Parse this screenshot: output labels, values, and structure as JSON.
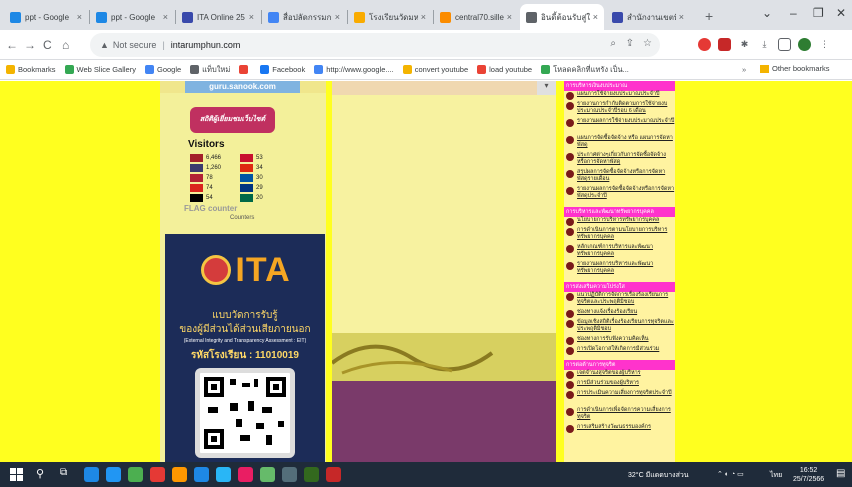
{
  "browser": {
    "tabs": [
      {
        "title": "ppt - Google",
        "color": "#1e88e5"
      },
      {
        "title": "ppt - Google",
        "color": "#1e88e5"
      },
      {
        "title": "ITA Online 25",
        "color": "#3949ab"
      },
      {
        "title": "สื่อปลัดกรรมการ",
        "color": "#4285f4"
      },
      {
        "title": "โรงเรียนวัดมหาก",
        "color": "#f9ab00"
      },
      {
        "title": "central70.sille",
        "color": "#fb8c00"
      },
      {
        "title": "อินดี้ต้อนรับสู่ใ",
        "color": "#5f6368"
      },
      {
        "title": "สำนักงานเขตพื้",
        "color": "#3949ab"
      }
    ],
    "active_tab_index": 6,
    "close_glyph": "×",
    "new_tab_glyph": "+",
    "window_controls": [
      "⌄",
      "–",
      "❐",
      "✕"
    ]
  },
  "address": {
    "back": "←",
    "forward": "→",
    "reload": "C",
    "home": "⌂",
    "security_label": "Not secure",
    "url": "intarumphun.com"
  },
  "bookmarks": [
    {
      "label": "Bookmarks",
      "color": "#f4b400"
    },
    {
      "label": "Web Slice Gallery",
      "color": "#34a853"
    },
    {
      "label": "Google",
      "color": "#4285f4"
    },
    {
      "label": "แท็บใหม่",
      "color": "#5f6368"
    },
    {
      "label": "",
      "color": "#ea4335"
    },
    {
      "label": "Facebook",
      "color": "#1877f2"
    },
    {
      "label": "http://www.google....",
      "color": "#4285f4"
    },
    {
      "label": "convert youtube",
      "color": "#f4b400"
    },
    {
      "label": "load youtube",
      "color": "#ea4335"
    },
    {
      "label": "โหลดคลิกที่แทรัง เป็น...",
      "color": "#34a853"
    }
  ],
  "other_bookmarks": "Other bookmarks",
  "bookmarks_more": "»",
  "page": {
    "left": {
      "gsite_label": "guru.sanook.com",
      "stats_label": "สถิติผู้เยี่ยมชมเว็บไซต์",
      "visitors_title": "Visitors",
      "visitors": [
        {
          "count": "6,466",
          "color": "#a3202a"
        },
        {
          "count": "53",
          "color": "#c8102e"
        },
        {
          "count": "1,260",
          "color": "#3c3b6e"
        },
        {
          "count": "34",
          "color": "#de2910"
        },
        {
          "count": "78",
          "color": "#b22234"
        },
        {
          "count": "30",
          "color": "#0055a4"
        },
        {
          "count": "74",
          "color": "#da251d"
        },
        {
          "count": "29",
          "color": "#003580"
        },
        {
          "count": "54",
          "color": "#000000"
        },
        {
          "count": "20",
          "color": "#006847"
        }
      ],
      "flag_counter": "FLAG counter",
      "counters_label": "Counters"
    },
    "ita": {
      "logo_text": "ITA",
      "line1": "แบบวัดการรับรู้",
      "line2": "ของผู้มีส่วนได้ส่วนเสียภายนอก",
      "line3": "(External Integrity and Transparency Assessment : EIT)",
      "line4": "รหัสโรงเรียน : 11010019"
    },
    "right_sections": [
      {
        "heading": "การบริหารเงินงบประมาณ",
        "items": [
          "แผนการใช้จ่ายงบประมาณประจำปี",
          "รายงานการกำกับติดตามการใช้จ่ายงบประมาณประจำปีรอบ 6 เดือน",
          "รายงานผลการใช้จ่ายงบประมาณประจำปี",
          "แผนการจัดซื้อจัดจ้าง หรือ แผนการจัดหาพัสดุ",
          "ประกาศต่างๆเกี่ยวกับการจัดซื้อจัดจ้างหรือการจัดหาพัสดุ",
          "สรุปผลการจัดซื้อจัดจ้างหรือการจัดหาพัสดุรายเดือน",
          "รายงานผลการจัดซื้อจัดจ้างหรือการจัดหาพัสดุประจำปี"
        ]
      },
      {
        "heading": "การบริหารและพัฒนาทรัพยากรบุคคล",
        "items": [
          "นโยบายการบริหารทรัพยากรบุคคล",
          "การดำเนินการตามนโยบายการบริหารทรัพยากรบุคคล",
          "หลักเกณฑ์การบริหารและพัฒนาทรัพยากรบุคคล",
          "รายงานผลการบริหารและพัฒนาทรัพยากรบุคคล"
        ]
      },
      {
        "heading": "การส่งเสริมความโปร่งใส",
        "items": [
          "แนวปฏิบัติการจัดการเรื่องร้องเรียนการทุจริตและประพฤติมิชอบ",
          "ช่องทางแจ้งเรื่องร้องเรียน",
          "ข้อมูลเชิงสถิติเรื่องร้องเรียนการทุจริตและประพฤติมิชอบ",
          "ช่องทางการรับฟังความคิดเห็น",
          "การเปิดโอกาสให้เกิดการมีส่วนร่วม"
        ]
      },
      {
        "heading": "การต่อต้านการทุจริต",
        "items": [
          "เจตจำนงสุจริตของผู้บริหาร",
          "การมีส่วนร่วมของผู้บริหาร",
          "การประเมินความเสี่ยงการทุจริตประจำปี",
          "การดำเนินการเพื่อจัดการความเสี่ยงการทุจริต",
          "การเสริมสร้างวัฒนธรรมองค์กร"
        ]
      }
    ]
  },
  "taskbar": {
    "apps": [
      "#1e88e5",
      "#2196f3",
      "#4caf50",
      "#e53935",
      "#ff9800",
      "#1e88e5",
      "#29b6f6",
      "#e91e63",
      "#66bb6a",
      "#546e7a",
      "#33691e",
      "#c62828"
    ],
    "weather": "32°C มีแดดบางส่วน",
    "lang": "ไทย",
    "time": "16:52",
    "date": "25/7/2566"
  }
}
